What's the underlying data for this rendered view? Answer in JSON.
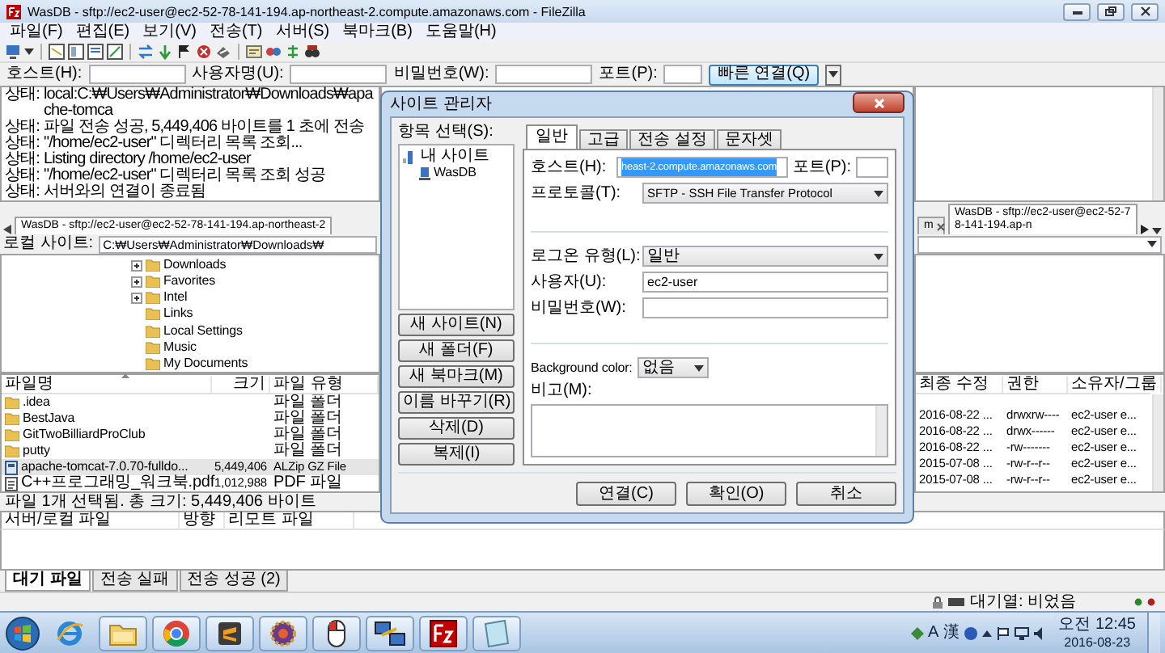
{
  "window": {
    "title": "WasDB - sftp://ec2-user@ec2-52-78-141-194.ap-northeast-2.compute.amazonaws.com - FileZilla"
  },
  "menu": [
    "파일(F)",
    "편집(E)",
    "보기(V)",
    "전송(T)",
    "서버(S)",
    "북마크(B)",
    "도움말(H)"
  ],
  "quickconnect": {
    "host_label": "호스트(H):",
    "user_label": "사용자명(U):",
    "password_label": "비밀번호(W):",
    "port_label": "포트(P):",
    "connect_button": "빠른 연결(Q)"
  },
  "log": [
    {
      "label": "상태:",
      "text": "local:C:₩Users₩Administrator₩Downloads₩apache-tomca"
    },
    {
      "label": "상태:",
      "text": "파일 전송 성공, 5,449,406 바이트를 1 초에 전송"
    },
    {
      "label": "상태:",
      "text": "\"/home/ec2-user\" 디렉터리 목록 조회..."
    },
    {
      "label": "상태:",
      "text": "Listing directory /home/ec2-user"
    },
    {
      "label": "상태:",
      "text": "\"/home/ec2-user\" 디렉터리 목록 조회 성공"
    },
    {
      "label": "상태:",
      "text": "서버와의 연결이 종료됨"
    }
  ],
  "local_tab": {
    "label": "WasDB - sftp://ec2-user@ec2-52-78-141-194.ap-northeast-2"
  },
  "remote_tabs": [
    {
      "label": "m",
      "close_button": true,
      "selected": false
    },
    {
      "label": "WasDB - sftp://ec2-user@ec2-52-78-141-194.ap-n",
      "close_button": false,
      "selected": true
    }
  ],
  "local_site": {
    "label": "로컬 사이트:",
    "path": "C:₩Users₩Administrator₩Downloads₩"
  },
  "local_tree": [
    {
      "label": "Downloads",
      "expandable": true
    },
    {
      "label": "Favorites",
      "expandable": true
    },
    {
      "label": "Intel",
      "expandable": true
    },
    {
      "label": "Links",
      "expandable": false
    },
    {
      "label": "Local Settings",
      "expandable": false
    },
    {
      "label": "Music",
      "expandable": false
    },
    {
      "label": "My Documents",
      "expandable": false
    }
  ],
  "local_files": {
    "columns": [
      "파일명",
      "크기",
      "파일 유형"
    ],
    "rows": [
      {
        "kind": "folder",
        "name": ".idea",
        "type": "파일 폴더",
        "selected": false
      },
      {
        "kind": "folder",
        "name": "BestJava",
        "type": "파일 폴더",
        "selected": false
      },
      {
        "kind": "folder",
        "name": "GitTwoBilliardProClub",
        "type": "파일 폴더",
        "selected": false
      },
      {
        "kind": "folder",
        "name": "putty",
        "type": "파일 폴더",
        "selected": false
      },
      {
        "kind": "archive",
        "name": "apache-tomcat-7.0.70-fulldo...",
        "size": "5,449,406",
        "type": "ALZip GZ File",
        "selected": true
      },
      {
        "kind": "pdf",
        "name": "C++프로그래밍_워크북.pdf",
        "size": "1,012,988",
        "type": "PDF 파일",
        "selected": false
      }
    ]
  },
  "local_status": "파일 1개 선택됨. 총 크기: 5,449,406 바이트",
  "remote_files": {
    "columns": [
      "최종 수정",
      "권한",
      "소유자/그룹"
    ],
    "rows": [
      {
        "modified": "2016-08-22 ...",
        "permissions": "drwxrw----",
        "owner": "ec2-user e..."
      },
      {
        "modified": "2016-08-22 ...",
        "permissions": "drwx------",
        "owner": "ec2-user e..."
      },
      {
        "modified": "2016-08-22 ...",
        "permissions": "-rw-------",
        "owner": "ec2-user e..."
      },
      {
        "modified": "2015-07-08 ...",
        "permissions": "-rw-r--r--",
        "owner": "ec2-user e..."
      },
      {
        "modified": "2015-07-08 ...",
        "permissions": "-rw-r--r--",
        "owner": "ec2-user e..."
      }
    ]
  },
  "queue": {
    "columns": [
      "서버/로컬 파일",
      "방향",
      "리모트 파일"
    ]
  },
  "queue_tabs": [
    {
      "label": "대기 파일",
      "selected": true
    },
    {
      "label": "전송 실패",
      "selected": false
    },
    {
      "label": "전송 성공 (2)",
      "selected": false
    }
  ],
  "status_bar": {
    "queue": "대기열: 비었음"
  },
  "site_manager": {
    "title": "사이트 관리자",
    "tree_label": "항목 선택(S):",
    "tree": [
      {
        "label": "내 사이트",
        "children": [
          {
            "label": "WasDB"
          }
        ]
      }
    ],
    "side_buttons": [
      "새 사이트(N)",
      "새 폴더(F)",
      "새 북마크(M)",
      "이름 바꾸기(R)",
      "삭제(D)",
      "복제(I)"
    ],
    "tabs": [
      {
        "label": "일반",
        "selected": true
      },
      {
        "label": "고급",
        "selected": false
      },
      {
        "label": "전송 설정",
        "selected": false
      },
      {
        "label": "문자셋",
        "selected": false
      }
    ],
    "host": {
      "label": "호스트(H):",
      "value": "heast-2.compute.amazonaws.com",
      "text_selected": true
    },
    "port": {
      "label": "포트(P):"
    },
    "protocol": {
      "label": "프로토콜(T):",
      "value": "SFTP - SSH File Transfer Protocol"
    },
    "logon_type": {
      "label": "로그온 유형(L):",
      "value": "일반"
    },
    "user": {
      "label": "사용자(U):",
      "value": "ec2-user"
    },
    "password": {
      "label": "비밀번호(W):"
    },
    "background_color": {
      "label": "Background color:",
      "value": "없음"
    },
    "comments": {
      "label": "비고(M):"
    },
    "buttons": [
      "연결(C)",
      "확인(O)",
      "취소"
    ]
  },
  "taskbar": {
    "apps": [
      {
        "kind": "ie"
      },
      {
        "kind": "explorer"
      },
      {
        "kind": "chrome"
      },
      {
        "kind": "sublime"
      },
      {
        "kind": "gear"
      },
      {
        "kind": "mouse"
      },
      {
        "kind": "network"
      },
      {
        "kind": "filezilla"
      },
      {
        "kind": "notepad"
      }
    ],
    "input_mode": "A",
    "hanja": "漢",
    "time": "오전 12:45",
    "date": "2016-08-23"
  }
}
